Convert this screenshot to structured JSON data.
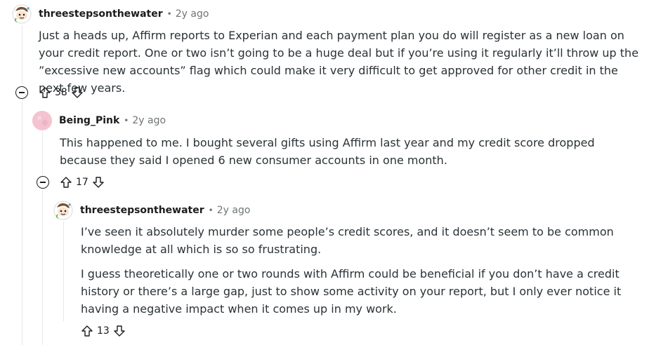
{
  "comments": [
    {
      "username": "threestepsonthewater",
      "dot": "•",
      "age": "2y ago",
      "paragraphs": [
        "Just a heads up, Affirm reports to Experian and each payment plan you do will register as a new loan on your credit report. One or two isn’t going to be a huge deal but if you’re using it regularly it’ll throw up the ”excessive new accounts” flag which could make it very difficult to get approved for other credit in the next few years."
      ],
      "score": "38",
      "avatar_icon": "snoo-avatar-icon"
    },
    {
      "username": "Being_Pink",
      "dot": "•",
      "age": "2y ago",
      "paragraphs": [
        "This happened to me. I bought several gifts using Affirm last year and my credit score dropped because they said I opened 6 new consumer accounts in one month."
      ],
      "score": "17",
      "avatar_icon": "pink-avatar-icon"
    },
    {
      "username": "threestepsonthewater",
      "dot": "•",
      "age": "2y ago",
      "paragraphs": [
        "I’ve seen it absolutely murder some people’s credit scores, and it doesn’t seem to be common knowledge at all which is so so frustrating.",
        "I guess theoretically one or two rounds with Affirm could be beneficial if you don’t have a credit history or there’s a large gap, just to show some activity on your report, but I only ever notice it having a negative impact when it comes up in my work."
      ],
      "score": "13",
      "avatar_icon": "snoo-avatar-icon"
    }
  ],
  "colors": {
    "text": "#2a3236",
    "meta": "#6f7577",
    "thread_line": "#e5e8ea",
    "pink_avatar": "#f3c4cf"
  }
}
